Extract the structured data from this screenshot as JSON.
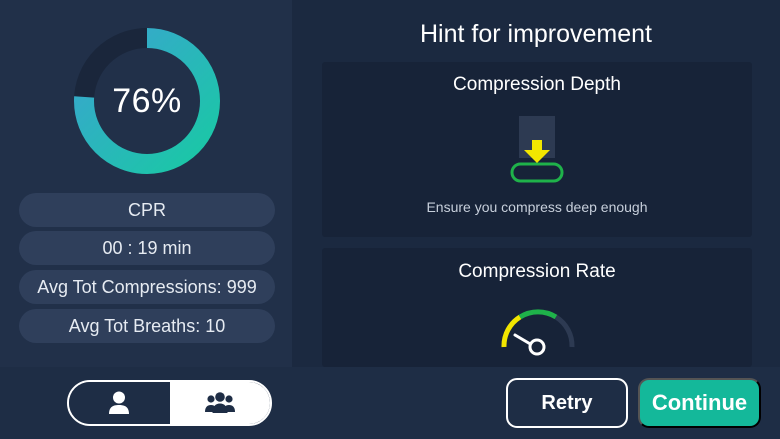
{
  "score": {
    "value": 76,
    "label": "76%"
  },
  "stats": [
    {
      "label": "CPR"
    },
    {
      "label": "00 : 19 min"
    },
    {
      "label": "Avg Tot Compressions: 999"
    },
    {
      "label": "Avg Tot Breaths: 10"
    }
  ],
  "hints": {
    "title": "Hint for improvement",
    "cards": [
      {
        "title": "Compression Depth",
        "description": "Ensure you compress deep enough",
        "icon": "compression-depth-icon"
      },
      {
        "title": "Compression Rate",
        "description": "",
        "icon": "rate-gauge-icon"
      }
    ]
  },
  "footer": {
    "mode_toggle": {
      "options": [
        "single-user",
        "group"
      ],
      "selected": "group"
    },
    "retry_label": "Retry",
    "continue_label": "Continue"
  },
  "colors": {
    "background": "#1b2940",
    "panel": "#213049",
    "card": "#172338",
    "pill": "#2f3f5b",
    "accent_teal": "#14b89a",
    "ring_start": "#19c9a4",
    "ring_end": "#3aa4d0",
    "arrow_yellow": "#f2e600",
    "pad_green": "#1fb24a"
  }
}
